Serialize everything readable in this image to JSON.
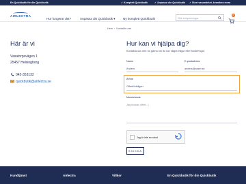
{
  "topbar": {
    "left_text": "En Quickbutik för din Quickbutik",
    "usps": [
      "Komplett Quickbutik",
      "Anpassa din Quickbutik",
      "Stort varumärket, kvantiera mera"
    ]
  },
  "header": {
    "logo_text": "AIRLECTRA",
    "nav": [
      "Hur fungerar det?",
      "Anpassa din Quickbutik",
      "Ny komplett Quickbutik"
    ],
    "search_placeholder": "Sök sneposningar",
    "cart_count": "0"
  },
  "breadcrumb": [
    "Hem",
    "Kontakta oss"
  ],
  "left": {
    "title": "Här är vi",
    "address": [
      "Vasatorpsvägen 1",
      "25457 Helsingborg"
    ],
    "phone": "042-353132",
    "email": "quickbutik@airlectra.se"
  },
  "form": {
    "title": "Hur kan vi hjälpa dig?",
    "intro": "Kontakta oss mer än gärna om du har några frågor eller funderingar.",
    "name_label": "Namn",
    "name_value": "Anders",
    "email_label": "E-postadress",
    "email_value": "anders@asset.se",
    "subject_label": "Ämne",
    "subject_value": "Offertförfrågan",
    "message_label": "Meddelande",
    "message_placeholder": "Jag önskar offert...)",
    "captcha_label": "Jag är inte en robot",
    "send_label": "SKICKA"
  },
  "footer": {
    "columns": [
      "Kundtjänst",
      "Airlectra",
      "Villkor",
      "En Quickbutik för din Quickbutik"
    ]
  },
  "colors": {
    "navy": "#1f2d55",
    "highlight": "#f2a23a",
    "link": "#2a5fa8"
  }
}
